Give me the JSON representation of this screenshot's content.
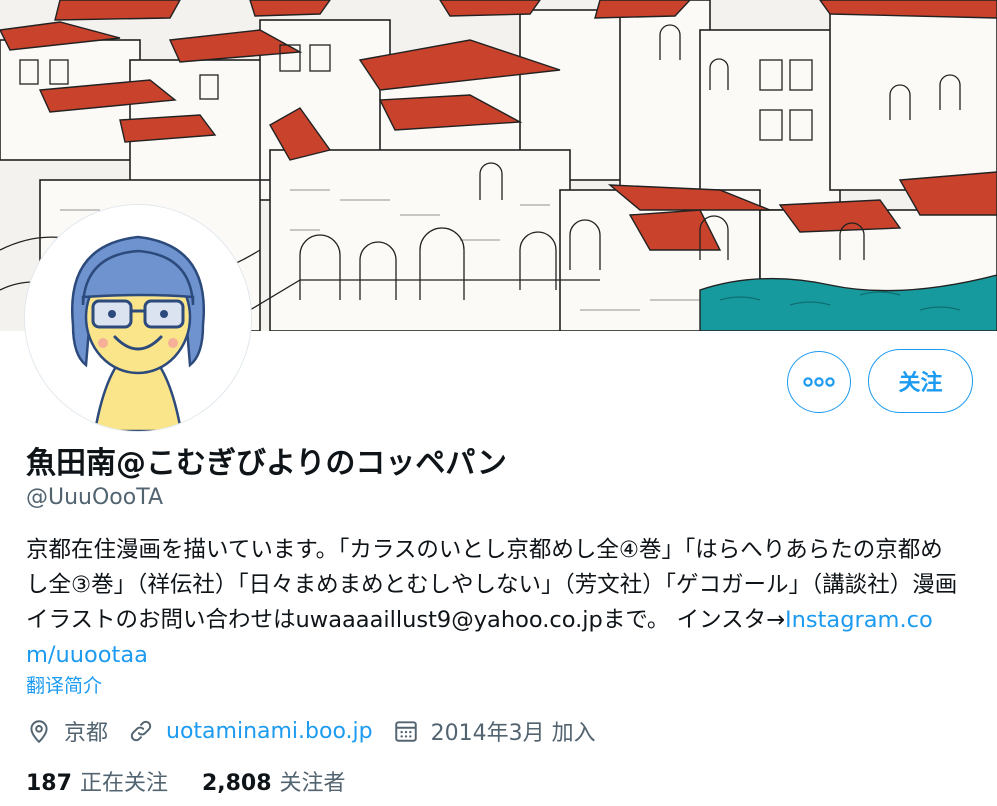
{
  "profile": {
    "name": "魚田南@こむぎびよりのコッペパン",
    "handle": "@UuuOooTA",
    "bio_text": "京都在住漫画を描いています。「カラスのいとし京都めし全④巻」「はらへりあらたの京都めし全③巻」（祥伝社）「日々まめまめとむしやしない」（芳文社）「ゲコガール」（講談社）漫画イラストのお問い合わせはuwaaaaillust9@yahoo.co.jpまで。 インスタ→",
    "bio_link": "Instagram.com/uuootaa",
    "translate_label": "翻译简介"
  },
  "actions": {
    "more_icon": "more-horizontal-icon",
    "follow_label": "关注"
  },
  "meta": {
    "location": "京都",
    "website": "uotaminami.boo.jp",
    "joined": "2014年3月 加入"
  },
  "stats": {
    "following_count": "187",
    "following_label": "正在关注",
    "followers_count": "2,808",
    "followers_label": "关注者"
  },
  "colors": {
    "accent": "#1d9bf0",
    "text_primary": "#0f1419",
    "text_secondary": "#536471",
    "roof_red": "#c9422c",
    "water_teal": "#179a9d",
    "avatar_hair": "#6f93cf",
    "avatar_face": "#fbe58a"
  }
}
